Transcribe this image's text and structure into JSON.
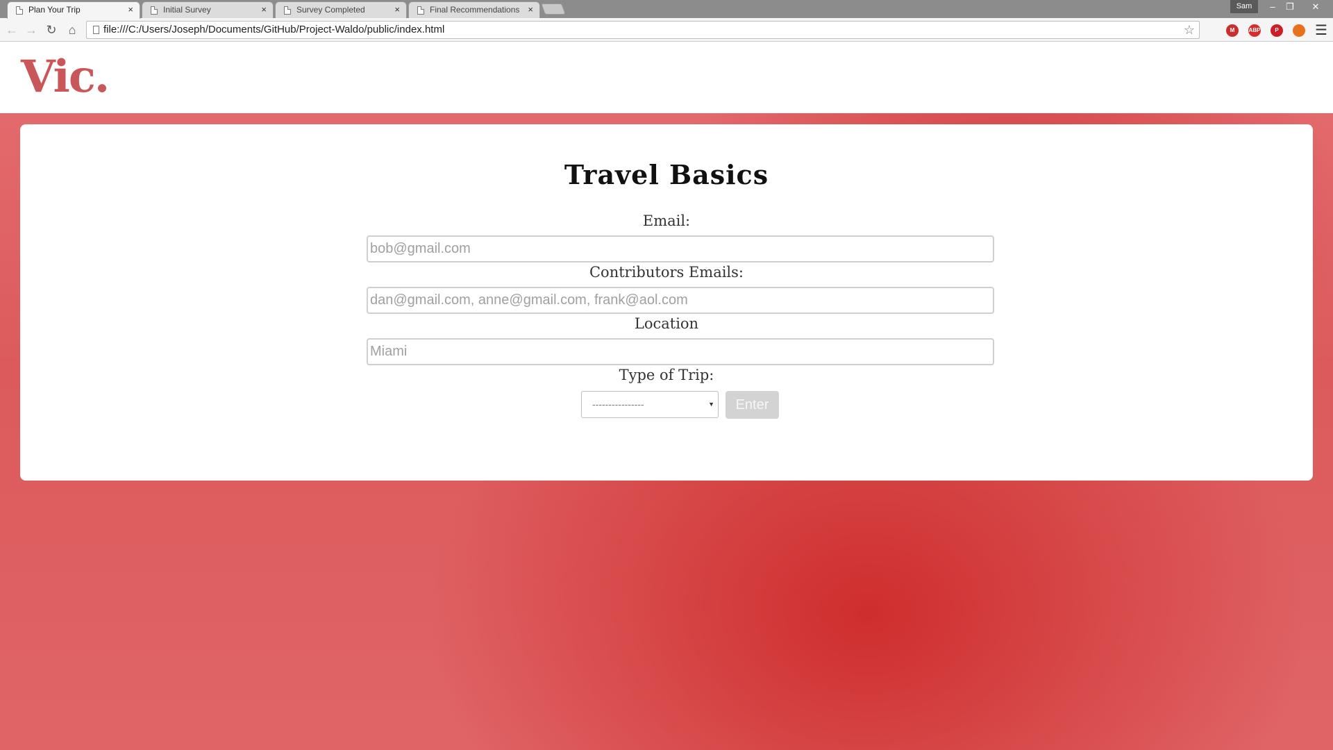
{
  "browser": {
    "tabs": [
      {
        "title": "Plan Your Trip",
        "active": true
      },
      {
        "title": "Initial Survey",
        "active": false
      },
      {
        "title": "Survey Completed",
        "active": false
      },
      {
        "title": "Final Recommendations",
        "active": false
      }
    ],
    "tab_close_glyph": "×",
    "profile_name": "Sam",
    "url": "file:///C:/Users/Joseph/Documents/GitHub/Project-Waldo/public/index.html",
    "extensions": [
      {
        "icon": "mendeley-icon",
        "label": "M",
        "color": "#c8302e"
      },
      {
        "icon": "adblock-plus-icon",
        "label": "ABP",
        "color": "#d62c2c"
      },
      {
        "icon": "pinterest-icon",
        "label": "P",
        "color": "#cb2027"
      },
      {
        "icon": "fire-icon",
        "label": "",
        "color": "#e8711c"
      }
    ]
  },
  "site": {
    "logo": "Vic."
  },
  "form": {
    "title": "Travel Basics",
    "email_label": "Email:",
    "email_placeholder": "bob@gmail.com",
    "contributors_label": "Contributors Emails:",
    "contributors_placeholder": "dan@gmail.com, anne@gmail.com, frank@aol.com",
    "location_label": "Location",
    "location_placeholder": "Miami",
    "trip_type_label": "Type of Trip:",
    "trip_type_selected": "----------------",
    "submit_label": "Enter"
  },
  "colors": {
    "brand": "#c9575a",
    "background_red": "#d84447",
    "button_disabled": "#d3d3d3"
  }
}
